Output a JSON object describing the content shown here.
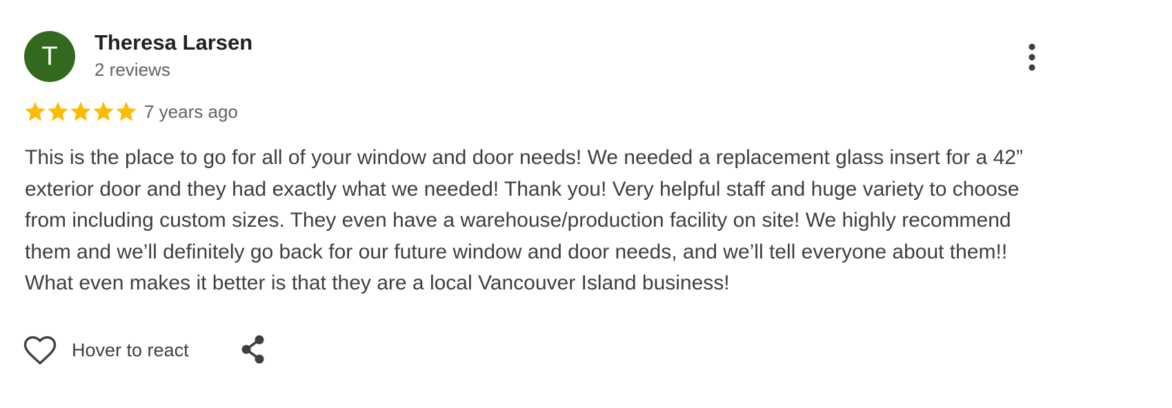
{
  "review": {
    "author": {
      "initial": "T",
      "name": "Theresa Larsen",
      "review_count": "2 reviews",
      "avatar_color": "#33691e"
    },
    "rating": {
      "stars": 5,
      "max_stars": 5,
      "star_color": "#fbbc04"
    },
    "date": "7 years ago",
    "text": "This is the place to go for all of your window and door needs! We needed a replacement glass insert for a 42” exterior door and they had exactly what we needed! Thank you! Very helpful staff and huge variety to choose from including custom sizes. They even have a warehouse/production facility on site! We highly recommend them and we’ll definitely go back for our future window and door needs, and we’ll tell everyone about them!! What even makes it better is that they are a local Vancouver Island business!",
    "actions": {
      "react_label": "Hover to react",
      "react_icon": "heart-outline-icon",
      "share_icon": "share-icon",
      "more_icon": "more-vertical-icon"
    }
  }
}
